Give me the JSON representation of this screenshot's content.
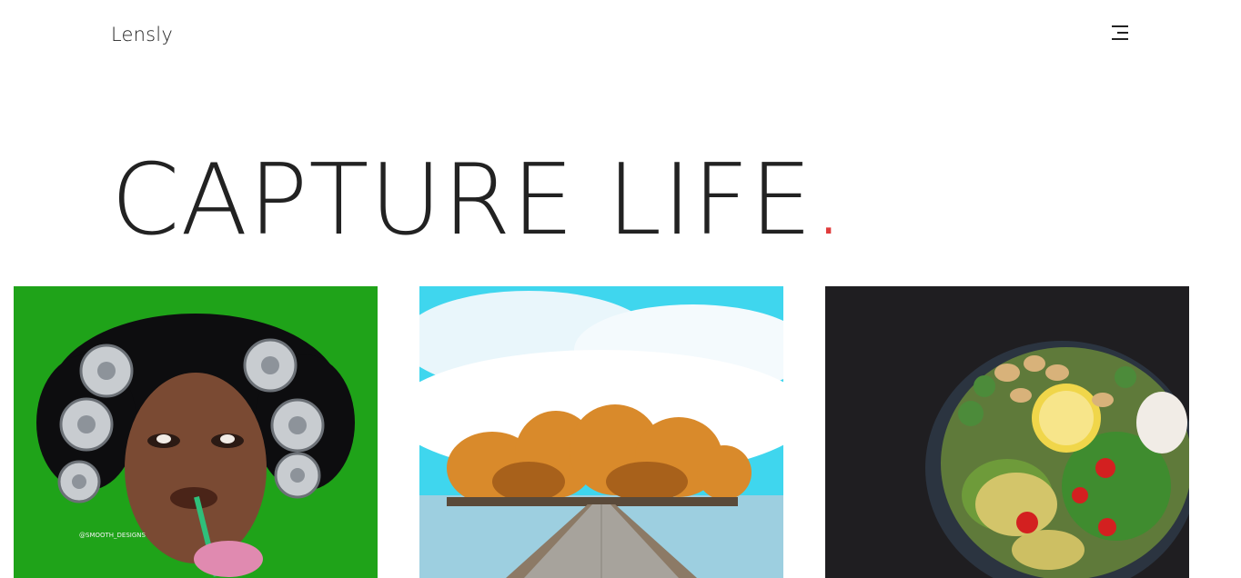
{
  "header": {
    "logo": "Lensly",
    "menu_icon": "hamburger-menu-icon"
  },
  "hero": {
    "title": "CAPTURE LIFE",
    "accent": ".",
    "accent_color": "#e03c3c"
  },
  "gallery": {
    "items": [
      {
        "subject": "portrait-with-can-curlers",
        "caption": "@SMOOTH_DESIGNS",
        "bg_color": "#1fa319"
      },
      {
        "subject": "boardwalk-to-autumn-island",
        "bg_color": "#3fd6ee"
      },
      {
        "subject": "salad-bowl",
        "bg_color": "#1c1b1d"
      }
    ]
  }
}
